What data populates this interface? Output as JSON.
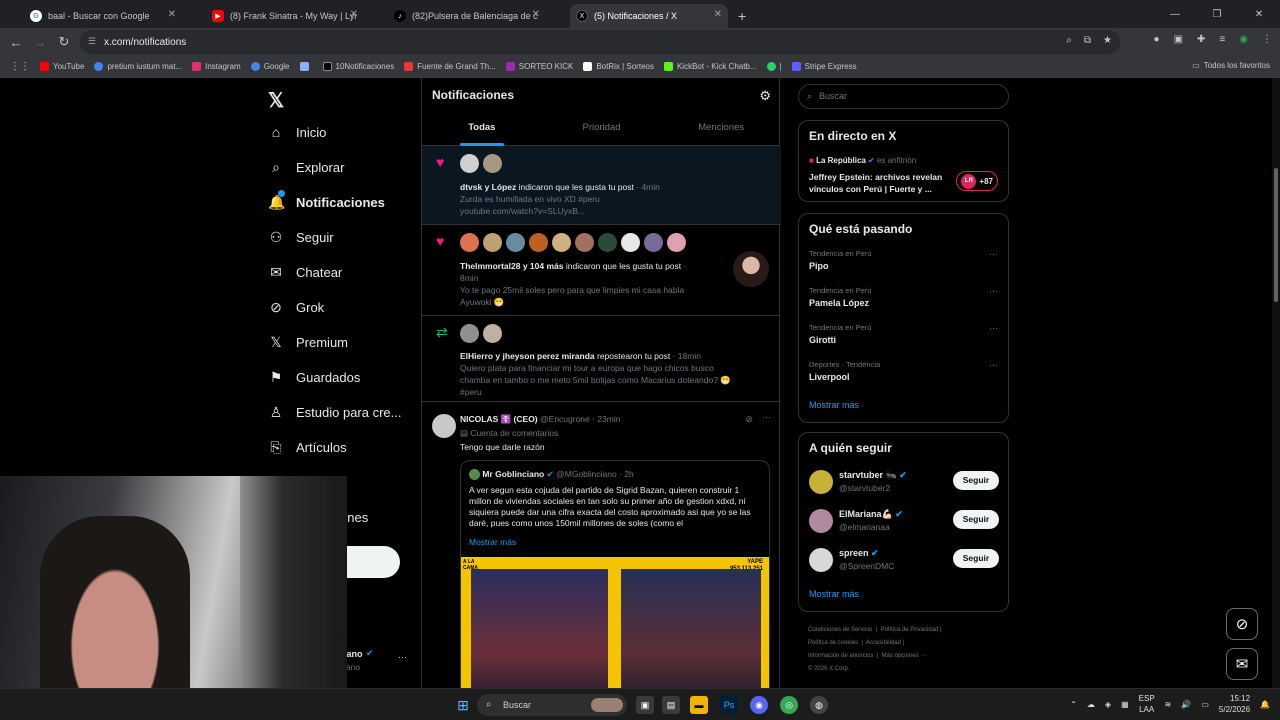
{
  "browser": {
    "tabs": [
      {
        "title": "baal - Buscar con Google",
        "icon": "google-icon",
        "color": "#ffffff"
      },
      {
        "title": "(8) Frank Sinatra - My Way | Lyr",
        "icon": "youtube-icon",
        "color": "#ff0000"
      },
      {
        "title": "(82)Pulsera de Balenciaga de c",
        "icon": "tiktok-icon",
        "color": "#000000"
      },
      {
        "title": "(5) Notificaciones / X",
        "icon": "x-icon",
        "color": "#000000"
      }
    ],
    "new_tab": "+",
    "url": "x.com/notifications",
    "bookmarks": [
      {
        "label": "YouTube",
        "color": "#ff0000"
      },
      {
        "label": "pretium iustum mat...",
        "color": "#4285f4"
      },
      {
        "label": "Instagram",
        "color": "#e1306c"
      },
      {
        "label": "Google",
        "color": "#4285f4"
      },
      {
        "label": "",
        "color": "#8ab4f8"
      },
      {
        "label": "10Notificaciones",
        "color": "#000000"
      },
      {
        "label": "Fuente de Grand Th...",
        "color": "#e53935"
      },
      {
        "label": "SORTEO KICK",
        "color": "#9c27b0"
      },
      {
        "label": "BotRix | Sorteos",
        "color": "#ffffff"
      },
      {
        "label": "KickBot - Kick Chatb...",
        "color": "#53fc18"
      },
      {
        "label": "|",
        "color": "#25d366"
      },
      {
        "label": "Stripe Express",
        "color": "#635bff"
      }
    ],
    "all_favorites": "Todos los favoritos"
  },
  "leftnav": {
    "items": [
      {
        "label": "Inicio",
        "icon": "home-icon",
        "glyph": "⌂"
      },
      {
        "label": "Explorar",
        "icon": "search-icon",
        "glyph": "⌕"
      },
      {
        "label": "Notificaciones",
        "icon": "bell-icon",
        "glyph": "🔔"
      },
      {
        "label": "Seguir",
        "icon": "add-person-icon",
        "glyph": "⚇"
      },
      {
        "label": "Chatear",
        "icon": "mail-icon",
        "glyph": "✉"
      },
      {
        "label": "Grok",
        "icon": "grok-icon",
        "glyph": "⊘"
      },
      {
        "label": "Premium",
        "icon": "x-icon",
        "glyph": "𝕏"
      },
      {
        "label": "Guardados",
        "icon": "bookmark-icon",
        "glyph": "⚑"
      },
      {
        "label": "Estudio para cre...",
        "icon": "studio-icon",
        "glyph": "♙"
      },
      {
        "label": "Artículos",
        "icon": "articles-icon",
        "glyph": "⎘"
      }
    ],
    "partial_more": "ones",
    "partial_user": "iano",
    "partial_handle": "iano",
    "more": "···"
  },
  "notifications": {
    "title": "Notificaciones",
    "tabs": [
      "Todas",
      "Prioridad",
      "Menciones"
    ],
    "items": [
      {
        "actors": "dtvsk y López",
        "action": " indicaron que les gusta tu post",
        "time": " · 4min",
        "text1": "Zurda es humillada en vivo XD #peru",
        "text2": "youtube.com/watch?v=SLUyxB..."
      },
      {
        "actors": "TheImmortal28 y 104 más",
        "action": " indicaron que les gusta tu post",
        "time": " · 8min",
        "text1": "Yo te pago 25mil soles pero para que limpies mi casa habla",
        "text2": "Ayuwoki 😁"
      },
      {
        "actors": "ElHierro y jheyson perez miranda",
        "action": " repostearon tu post",
        "time": " · 18min",
        "text1": "Quiero plata para financiar mi tour a europa que hago chicos busco",
        "text2": "chamba en tambo o me meto 5mil botijas como Macarius doteando? 😁",
        "text3": "#peru"
      }
    ],
    "post": {
      "name": "NICOLAS ☦️ (CEO)",
      "handle": "@Encugrone",
      "time": "· 23min",
      "sub": "Cuenta de comentarios",
      "body": "Tengo que darle razón",
      "quote": {
        "name": "Mr Goblinciano",
        "handle": "@MGoblinciano",
        "time": "· 2h",
        "text": "A ver segun esta cojuda del partido de Sigrid Bazan, quieren construir 1 millon de viviendas sociales en tan solo su primer año de gestion xdxd, ni siquiera puede dar una cifra exacta del costo aproximado asi que yo se las daré, pues como unos 150mil millones de soles (como el",
        "more": "Mostrar más",
        "image_label": "YAPE",
        "image_number": "953 113 251",
        "image_tag": "A LA CAMA"
      }
    }
  },
  "sidebar": {
    "search_placeholder": "Buscar",
    "live": {
      "title": "En directo en X",
      "source": "La República",
      "role": "es anfitrión",
      "headline1": "Jeffrey Epstein: archivos revelan",
      "headline2": "vínculos con Perú | Fuerte y ...",
      "badge": "LR",
      "count": "+87"
    },
    "trends": {
      "title": "Qué está pasando",
      "items": [
        {
          "context": "Tendencia en Perú",
          "name": "Pipo"
        },
        {
          "context": "Tendencia en Perú",
          "name": "Pamela López"
        },
        {
          "context": "Tendencia en Perú",
          "name": "Girotti"
        },
        {
          "context": "Deportes · Tendencia",
          "name": "Liverpool"
        }
      ],
      "more": "Mostrar más",
      "dots": "···"
    },
    "follow": {
      "title": "A quién seguir",
      "items": [
        {
          "name": "starvtuber 🐜",
          "handle": "@starvtuber2",
          "button": "Seguir",
          "color": "#c9b037"
        },
        {
          "name": "ElMariana💪🏻",
          "handle": "@elmarianaa",
          "button": "Seguir",
          "color": "#b08aa0"
        },
        {
          "name": "spreen",
          "handle": "@SpreenDMC",
          "button": "Seguir",
          "color": "#d8d8d8"
        }
      ],
      "more": "Mostrar más"
    },
    "footer": {
      "l1a": "Condiciones de Servicio",
      "l1b": "Política de Privacidad",
      "l2a": "Política de cookies",
      "l2b": "Accesibilidad",
      "l3a": "Información de anuncios",
      "l3b": "Más opciones ···",
      "l4": "© 2026 X Corp."
    }
  },
  "taskbar": {
    "search": "Buscar",
    "lang1": "ESP",
    "lang2": "LAA",
    "time": "15:12",
    "date": "5/2/2026"
  }
}
